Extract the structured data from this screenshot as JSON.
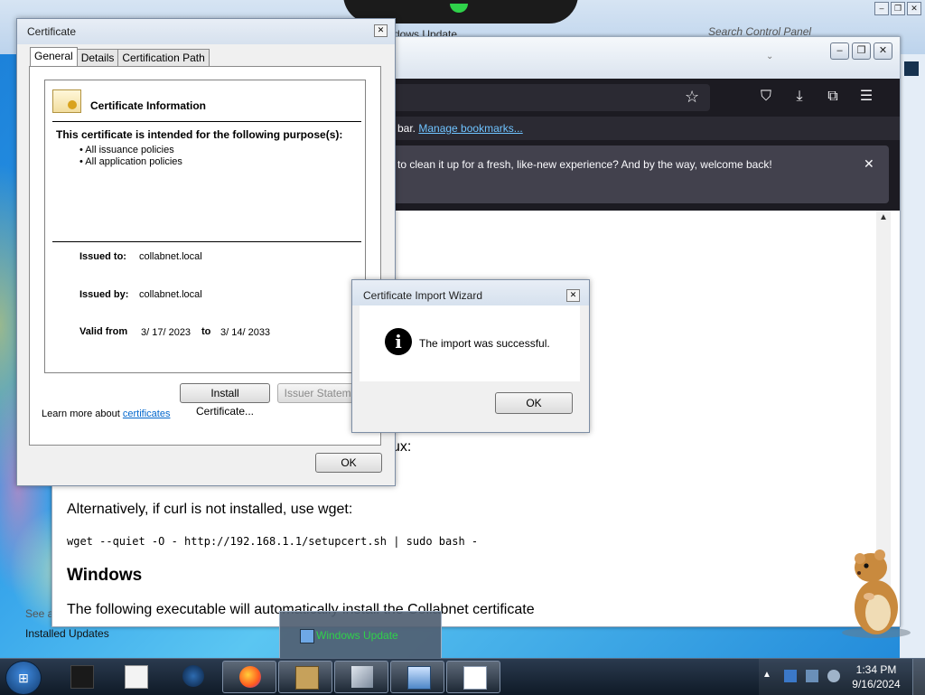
{
  "control_panel": {
    "title_partial": "dows Update",
    "search_placeholder": "Search Control Panel",
    "see_also_partial": "See a",
    "installed_updates": "Installed Updates"
  },
  "firefox": {
    "bookmarks_text": "bar.",
    "manage_bookmarks": "Manage bookmarks...",
    "notification": "to clean it up for a fresh, like-new experience? And by the way, welcome back!",
    "content": {
      "linux_partial": "ux:",
      "alt_text": "Alternatively, if curl is not installed, use wget:",
      "code": "wget --quiet -O - http://192.168.1.1/setupcert.sh | sudo bash -",
      "heading": "Windows",
      "follow_text": "The following executable will automatically install the Collabnet certificate"
    }
  },
  "certificate": {
    "title": "Certificate",
    "tabs": [
      "General",
      "Details",
      "Certification Path"
    ],
    "info_heading": "Certificate Information",
    "purpose_heading": "This certificate is intended for the following purpose(s):",
    "purposes": [
      "• All issuance policies",
      "• All application policies"
    ],
    "issued_to_label": "Issued to:",
    "issued_to": "collabnet.local",
    "issued_by_label": "Issued by:",
    "issued_by": "collabnet.local",
    "valid_from_label": "Valid from",
    "valid_from": "3/ 17/ 2023",
    "to_label": "to",
    "valid_to": "3/ 14/ 2033",
    "install_button": "Install Certificate...",
    "issuer_button": "Issuer Statement",
    "learn_more": "Learn more about",
    "learn_link": "certificates",
    "ok_button": "OK"
  },
  "wizard": {
    "title": "Certificate Import Wizard",
    "message": "The import was successful.",
    "ok_button": "OK"
  },
  "taskbar": {
    "thumbnail_label": "Windows Update",
    "time": "1:34 PM",
    "date": "9/16/2024"
  }
}
